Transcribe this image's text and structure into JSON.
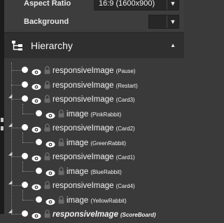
{
  "properties": {
    "aspect_ratio": {
      "label": "Aspect Ratio",
      "value": "16:9 (1600x900)"
    },
    "background": {
      "label": "Background",
      "value": ""
    }
  },
  "hierarchy": {
    "title": "Hierarchy",
    "items": [
      {
        "name": "responsiveImage",
        "suffix": "(Pause)"
      },
      {
        "name": "responsiveImage",
        "suffix": "(Restart)"
      },
      {
        "name": "responsiveImage",
        "suffix": "(Card3)"
      },
      {
        "name": "image",
        "suffix": "(PinkRabbit)"
      },
      {
        "name": "responsiveImage",
        "suffix": "(Card2)"
      },
      {
        "name": "image",
        "suffix": "(GreenRabbit)"
      },
      {
        "name": "responsiveImage",
        "suffix": "(Card1)"
      },
      {
        "name": "image",
        "suffix": "(BlueRabbit)"
      },
      {
        "name": "responsiveImage",
        "suffix": "(Card4)"
      },
      {
        "name": "image",
        "suffix": "(YellowRabbit)"
      },
      {
        "name": "responsiveImage",
        "suffix": "(ScoreBoard)"
      }
    ]
  },
  "icons": {
    "hierarchy": "tree-hierarchy-icon",
    "visibility": "eye-icon",
    "lock": "lock-icon",
    "expand": "expand-arrow-icon",
    "collapse": "collapse-arrow-icon",
    "dropdown": "chevron-down-icon"
  },
  "colors": {
    "panel_bg": "#3a3a3a",
    "header_bg": "#2f2f2f",
    "field_bg": "#272727",
    "text": "#f2f2f2"
  }
}
